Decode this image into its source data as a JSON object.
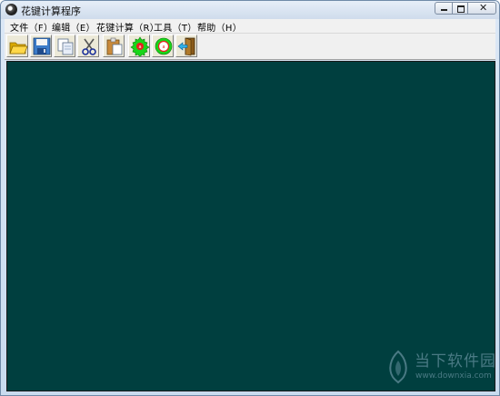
{
  "window": {
    "title": "花键计算程序"
  },
  "menu": [
    {
      "label": "文件（F）"
    },
    {
      "label": "编辑（E）"
    },
    {
      "label": "花键计算（R）"
    },
    {
      "label": "工具（T）"
    },
    {
      "label": "帮助（H）"
    }
  ],
  "toolbar": [
    {
      "icon": "open-folder-icon"
    },
    {
      "icon": "save-disk-icon"
    },
    {
      "icon": "copy-icon"
    },
    {
      "icon": "cut-scissors-icon"
    },
    {
      "icon": "paste-icon"
    },
    {
      "icon": "spline-gear-icon"
    },
    {
      "icon": "spline-ring-icon"
    },
    {
      "icon": "exit-door-icon"
    }
  ],
  "colors": {
    "canvas": "#003f3f"
  },
  "watermark": {
    "name": "当下软件园",
    "url": "www.downxia.com"
  }
}
